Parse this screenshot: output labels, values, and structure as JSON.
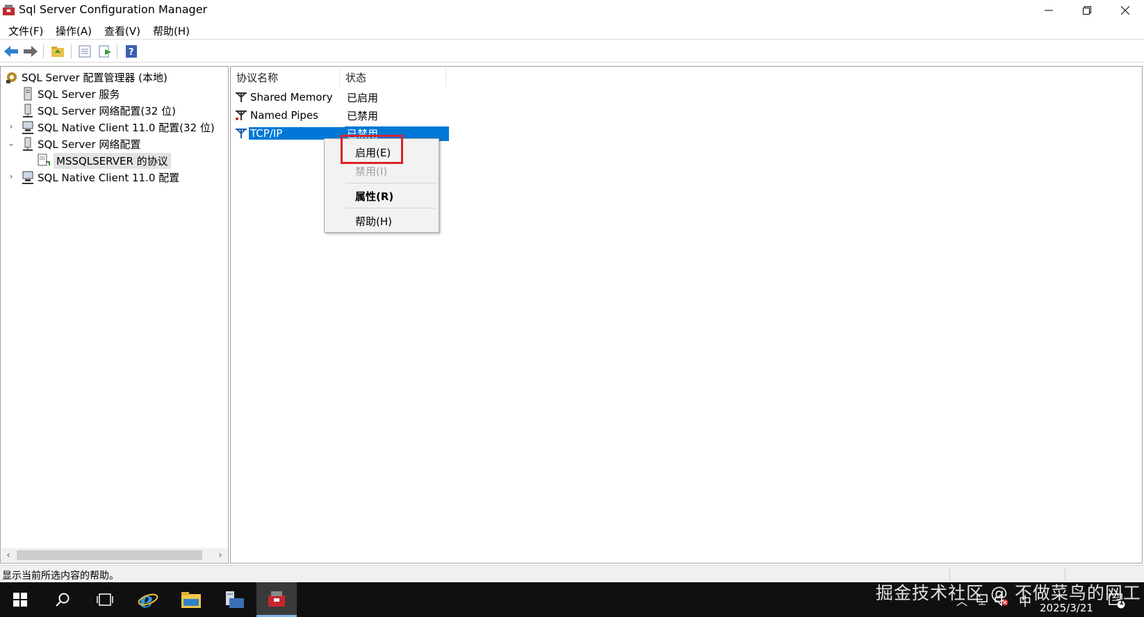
{
  "window": {
    "title": "Sql Server Configuration Manager"
  },
  "menubar": {
    "items": [
      "文件(F)",
      "操作(A)",
      "查看(V)",
      "帮助(H)"
    ]
  },
  "tree": {
    "items": [
      {
        "label": "SQL Server 配置管理器 (本地)",
        "icon": "config-manager-icon"
      },
      {
        "label": "SQL Server 服务",
        "icon": "server-icon"
      },
      {
        "label": "SQL Server 网络配置(32 位)",
        "icon": "network-config-icon"
      },
      {
        "label": "SQL Native Client 11.0 配置(32 位)",
        "icon": "native-client-icon",
        "expander": "collapsed"
      },
      {
        "label": "SQL Server 网络配置",
        "icon": "network-config-icon",
        "expander": "expanded"
      },
      {
        "label": "MSSQLSERVER 的协议",
        "icon": "protocols-icon",
        "selected": true
      },
      {
        "label": "SQL Native Client 11.0 配置",
        "icon": "native-client-icon",
        "expander": "collapsed"
      }
    ]
  },
  "list": {
    "columns": [
      "协议名称",
      "状态"
    ],
    "rows": [
      {
        "name": "Shared Memory",
        "state": "已启用"
      },
      {
        "name": "Named Pipes",
        "state": "已禁用"
      },
      {
        "name": "TCP/IP",
        "state": "已禁用",
        "selected": true
      }
    ]
  },
  "context_menu": {
    "items": [
      {
        "label": "启用(E)",
        "state": "enabled",
        "highlighted": true
      },
      {
        "label": "禁用(I)",
        "state": "disabled"
      },
      {
        "label": "属性(R)",
        "state": "enabled",
        "bold": true
      },
      {
        "label": "帮助(H)",
        "state": "enabled"
      }
    ],
    "highlight_color": "#e0202a"
  },
  "statusbar": {
    "text": "显示当前所选内容的帮助。"
  },
  "taskbar": {
    "date": "2025/3/21",
    "notification_count": "1"
  },
  "watermark": {
    "text": "掘金技术社区 @ 不做菜鸟的网工"
  },
  "colors": {
    "selection": "#0078d7",
    "taskbar": "#101010"
  }
}
